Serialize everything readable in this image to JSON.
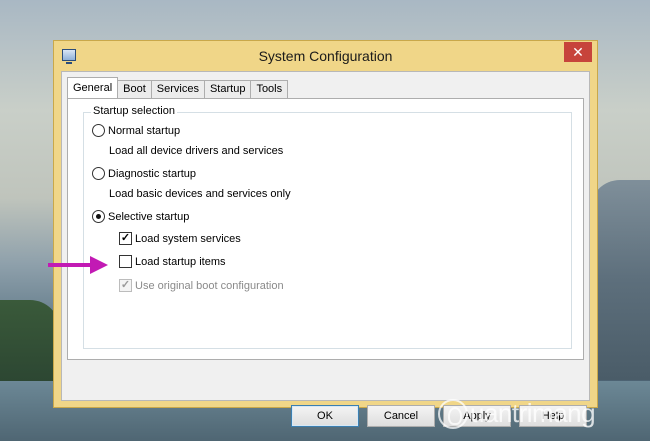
{
  "window": {
    "title": "System Configuration",
    "close_glyph": "✕"
  },
  "tabs": [
    {
      "label": "General",
      "active": true
    },
    {
      "label": "Boot",
      "active": false
    },
    {
      "label": "Services",
      "active": false
    },
    {
      "label": "Startup",
      "active": false
    },
    {
      "label": "Tools",
      "active": false
    }
  ],
  "startup_selection": {
    "group_label": "Startup selection",
    "normal": {
      "label": "Normal startup",
      "description": "Load all device drivers and services",
      "selected": false
    },
    "diagnostic": {
      "label": "Diagnostic startup",
      "description": "Load basic devices and services only",
      "selected": false
    },
    "selective": {
      "label": "Selective startup",
      "selected": true
    },
    "options": {
      "load_system_services": {
        "label": "Load system services",
        "checked": true
      },
      "load_startup_items": {
        "label": "Load startup items",
        "checked": false
      },
      "use_original_boot": {
        "label": "Use original boot configuration",
        "checked": true,
        "disabled": true
      }
    }
  },
  "buttons": {
    "ok": "OK",
    "cancel": "Cancel",
    "apply": "Apply",
    "help": "Help"
  },
  "annotation": {
    "arrow_color": "#c21ab4"
  },
  "watermark": {
    "text": "uantrimang"
  },
  "colors": {
    "title_bar": "#f0d688",
    "close_button": "#c7443b"
  }
}
